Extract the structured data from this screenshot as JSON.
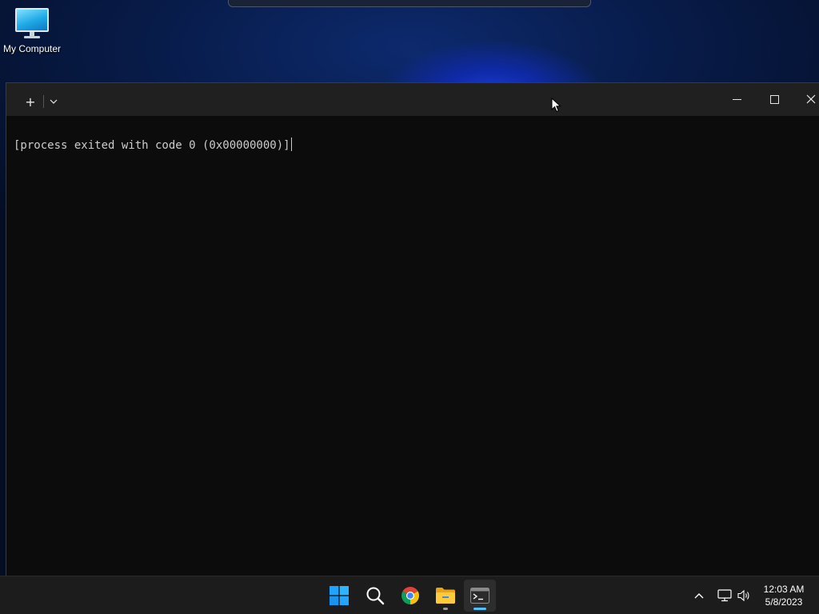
{
  "desktop": {
    "icons": [
      {
        "label": "My Computer",
        "icon": "monitor-icon"
      }
    ]
  },
  "terminal": {
    "new_tab_label": "+",
    "output_line": "[process exited with code 0 (0x00000000)]"
  },
  "taskbar": {
    "apps": [
      {
        "name": "start-button",
        "icon": "windows-logo-icon"
      },
      {
        "name": "search-button",
        "icon": "search-icon"
      },
      {
        "name": "chrome-button",
        "icon": "chrome-icon"
      },
      {
        "name": "file-explorer-button",
        "icon": "folder-icon"
      },
      {
        "name": "terminal-button",
        "icon": "terminal-icon",
        "active": true
      }
    ],
    "tray": {
      "time": "12:03 AM",
      "date": "5/8/2023"
    }
  },
  "colors": {
    "accent": "#4cc2ff",
    "terminal_bg": "#0c0c0c",
    "titlebar_bg": "#202020",
    "taskbar_bg": "#1c1c1c"
  }
}
